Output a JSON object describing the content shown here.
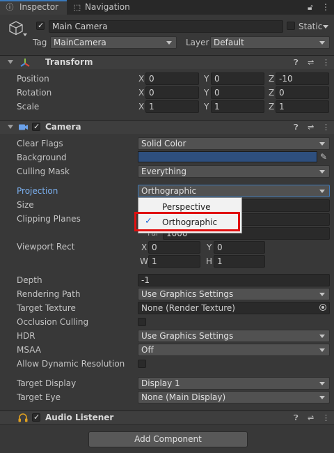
{
  "tabs": {
    "inspector": "Inspector",
    "navigation": "Navigation"
  },
  "header": {
    "object_name": "Main Camera",
    "static_label": "Static",
    "tag_label": "Tag",
    "tag_value": "MainCamera",
    "layer_label": "Layer",
    "layer_value": "Default"
  },
  "transform": {
    "title": "Transform",
    "position": {
      "label": "Position",
      "x": "0",
      "y": "0",
      "z": "-10"
    },
    "rotation": {
      "label": "Rotation",
      "x": "0",
      "y": "0",
      "z": "0"
    },
    "scale": {
      "label": "Scale",
      "x": "1",
      "y": "1",
      "z": "1"
    },
    "axes": {
      "x": "X",
      "y": "Y",
      "z": "Z",
      "w": "W",
      "h": "H"
    }
  },
  "camera": {
    "title": "Camera",
    "clear_flags": {
      "label": "Clear Flags",
      "value": "Solid Color"
    },
    "background": {
      "label": "Background",
      "color": "#2e4f7e"
    },
    "culling_mask": {
      "label": "Culling Mask",
      "value": "Everything"
    },
    "projection": {
      "label": "Projection",
      "value": "Orthographic"
    },
    "size": {
      "label": "Size"
    },
    "clipping_planes": {
      "label": "Clipping Planes",
      "far_label": "Far",
      "far_value": "1000"
    },
    "viewport_rect": {
      "label": "Viewport Rect",
      "x": "0",
      "y": "0",
      "w": "1",
      "h": "1"
    },
    "depth": {
      "label": "Depth",
      "value": "-1"
    },
    "rendering_path": {
      "label": "Rendering Path",
      "value": "Use Graphics Settings"
    },
    "target_texture": {
      "label": "Target Texture",
      "value": "None (Render Texture)"
    },
    "occlusion_culling": {
      "label": "Occlusion Culling"
    },
    "hdr": {
      "label": "HDR",
      "value": "Use Graphics Settings"
    },
    "msaa": {
      "label": "MSAA",
      "value": "Off"
    },
    "allow_dynamic_resolution": {
      "label": "Allow Dynamic Resolution"
    },
    "target_display": {
      "label": "Target Display",
      "value": "Display 1"
    },
    "target_eye": {
      "label": "Target Eye",
      "value": "None (Main Display)"
    }
  },
  "projection_popup": {
    "options": [
      "Perspective",
      "Orthographic"
    ],
    "selected": "Orthographic"
  },
  "audio_listener": {
    "title": "Audio Listener"
  },
  "add_component": "Add Component",
  "colors": {
    "accent_blue": "#3a79bb",
    "highlight_red": "#e01010",
    "projection_label": "#7bb0f0"
  }
}
